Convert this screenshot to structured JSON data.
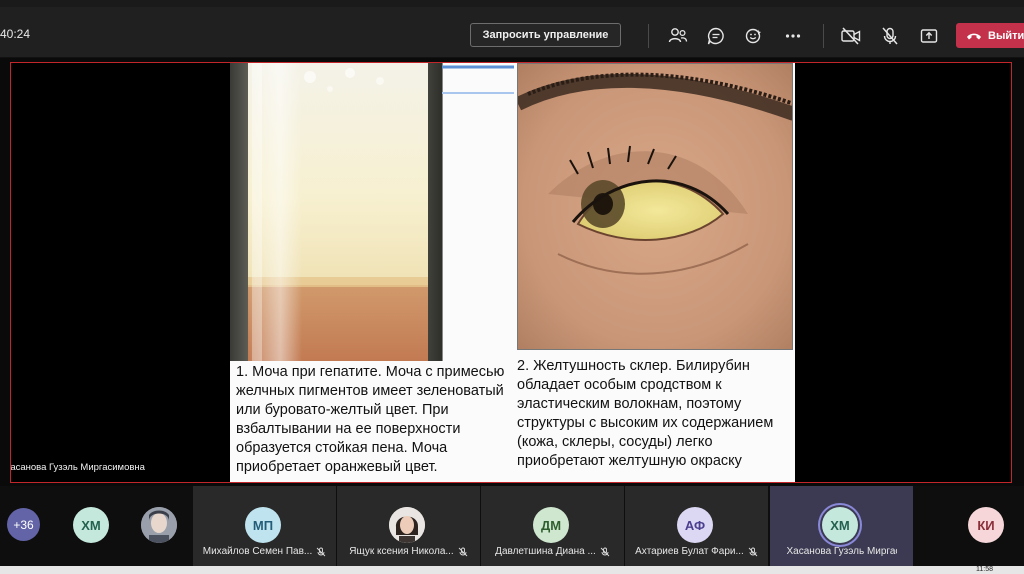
{
  "toolbar": {
    "timer": "40:24",
    "request_control_label": "Запросить управление",
    "leave_label": "Выйти",
    "icons": [
      "participants-icon",
      "chat-icon",
      "reactions-icon",
      "more-icon",
      "camera-off-icon",
      "mic-off-icon",
      "share-icon",
      "phone-hangup-icon"
    ]
  },
  "stage": {
    "presenter_name": "Хасанова Гузэль Миргасимовна",
    "slide": {
      "left_caption": "1.  Моча при гепатите. Моча с примесью желчных пигментов имеет зеленоватый или буровато-желтый цвет. При взбалтывании на ее поверхности образуется стойкая пена. Моча приобретает оранжевый цвет.",
      "right_caption": "2. Желтушность  склер. Билирубин обладает особым сродством к эластическим волокнам, поэтому структуры с высоким их содержанием (кожа, склеры, сосуды) легко приобретают желтушную окраску"
    }
  },
  "participants": {
    "more_count": "+36",
    "avatars": [
      {
        "initials": "ХМ",
        "bg": "#c5e8dd",
        "fg": "#24614f"
      },
      {
        "initials": "",
        "bg": "#8a8f9c",
        "fg": "#ffffff"
      }
    ],
    "tiles": [
      {
        "name": "Михайлов Семен Пав...",
        "initials": "МП",
        "bg": "#bfe4f0",
        "fg": "#245d78"
      },
      {
        "name": "Ящук ксения Никола...",
        "initials": "",
        "bg": "#d9d9d9",
        "fg": "#333333"
      },
      {
        "name": "Давлетшина Диана ...",
        "initials": "ДМ",
        "bg": "#cfe7cf",
        "fg": "#2f5f2f"
      },
      {
        "name": "Ахтариев Булат Фари...",
        "initials": "АФ",
        "bg": "#dcd7f3",
        "fg": "#4b3f8f"
      },
      {
        "name": "Хасанова Гузэль Миргас...",
        "initials": "ХМ",
        "bg": "#c5e8dd",
        "fg": "#24614f"
      }
    ],
    "last_avatar": {
      "initials": "КИ",
      "bg": "#f6d6d8",
      "fg": "#8a2f3a"
    }
  },
  "taskbar": {
    "clock": "11:58"
  },
  "colors": {
    "leave": "#c4314b",
    "stage_border": "#c2252a",
    "accent": "#6264a7"
  }
}
